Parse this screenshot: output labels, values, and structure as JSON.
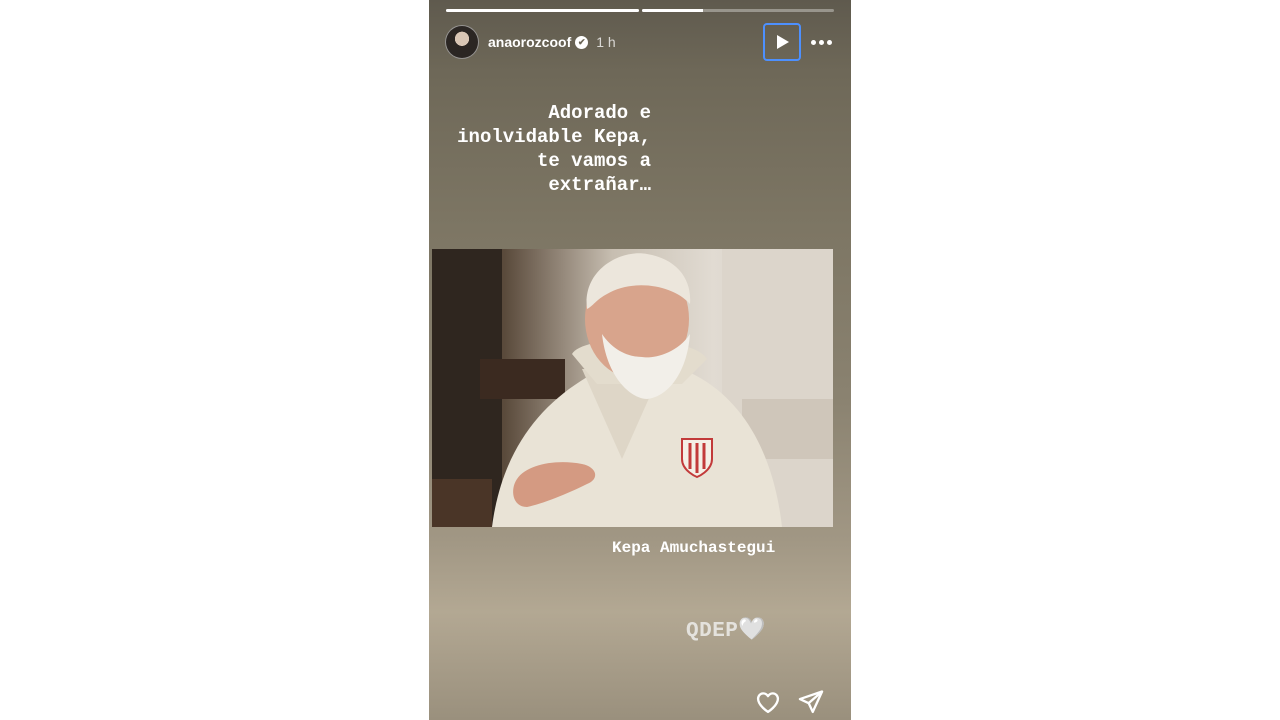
{
  "story": {
    "progress": [
      1,
      0.32
    ],
    "header": {
      "username": "anaorozcoof",
      "verified_mark": "✔",
      "time": "1 h",
      "play_icon": "play-icon",
      "more_icon": "more-horizontal-icon"
    },
    "caption_lines": [
      "Adorado e",
      "inolvidable Kepa,",
      "te vamos a",
      "extrañar…"
    ],
    "photo_label": "Kepa Amuchastegui",
    "qdep_text": "QDEP",
    "qdep_emoji": "🤍",
    "footer": {
      "like_icon": "heart-outline-icon",
      "share_icon": "paper-plane-icon"
    }
  },
  "colors": {
    "focus_ring": "#4d90fe",
    "story_bg_top": "#5f5a4e",
    "story_bg_bottom": "#b3a893"
  }
}
